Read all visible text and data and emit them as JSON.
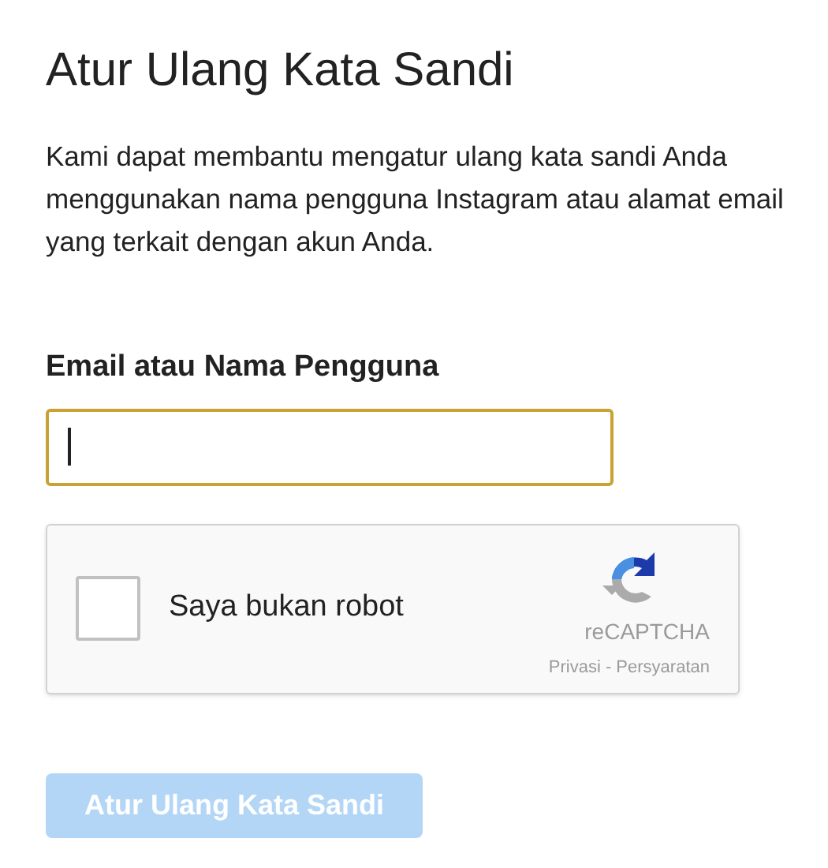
{
  "title": "Atur Ulang Kata Sandi",
  "description": "Kami dapat membantu mengatur ulang kata sandi Anda menggunakan nama pengguna Instagram atau alamat email yang terkait dengan akun Anda.",
  "field": {
    "label": "Email atau Nama Pengguna",
    "focused": true
  },
  "captcha": {
    "label": "Saya bukan robot",
    "checked": false,
    "brand": "reCAPTCHA",
    "links": "Privasi - Persyaratan"
  },
  "submit": {
    "label": "Atur Ulang Kata Sandi",
    "disabled": true
  }
}
